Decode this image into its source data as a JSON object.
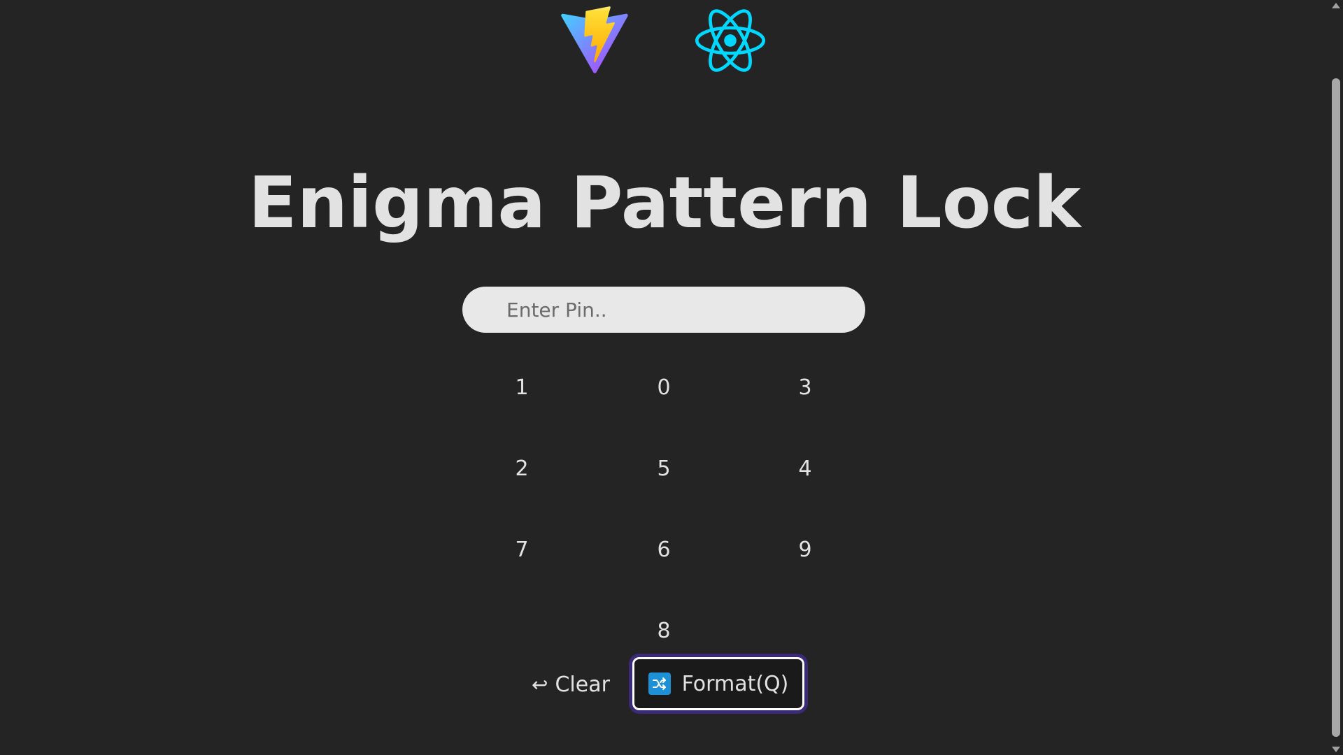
{
  "logos": [
    {
      "name": "vite-logo",
      "icon": "vite-icon"
    },
    {
      "name": "react-logo",
      "icon": "react-icon"
    }
  ],
  "title": "Enigma Pattern Lock",
  "pin_input": {
    "placeholder": "Enter Pin..",
    "value": ""
  },
  "keypad": {
    "keys": [
      "1",
      "0",
      "3",
      "2",
      "5",
      "4",
      "7",
      "6",
      "9",
      "8"
    ]
  },
  "actions": {
    "clear_icon": "↩",
    "clear_label": "Clear",
    "format_icon": "shuffle-icon",
    "format_label": "Format(Q)"
  },
  "colors": {
    "background": "#242424",
    "input_bg": "#e8e8e8",
    "focus_ring": "#3b2a78",
    "shuffle_icon_bg": "#1e90d6",
    "react_cyan": "#00d8ff"
  }
}
